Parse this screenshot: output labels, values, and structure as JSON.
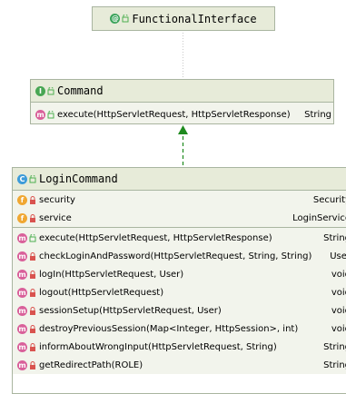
{
  "colors": {
    "node_border": "#a9b5a0",
    "header_bg": "#e7ebd9",
    "body_bg": "#f2f4ec",
    "arrow": "#1e8a1e",
    "icon_annotation": "#3aa35a",
    "icon_interface": "#48a653",
    "icon_class": "#3d9bd9",
    "icon_field": "#f0a732",
    "icon_method": "#d9609a",
    "public_icon": "#4caf50",
    "private_icon": "#d9534f"
  },
  "nodes": {
    "functional_interface": {
      "icon": "@",
      "visibility": "public",
      "title": "FunctionalInterface"
    },
    "command": {
      "icon": "I",
      "visibility": "public",
      "title": "Command",
      "methods": [
        {
          "icon": "m",
          "visibility": "public",
          "signature": "execute(HttpServletRequest, HttpServletResponse)",
          "type": "String"
        }
      ]
    },
    "login_command": {
      "icon": "C",
      "visibility": "public",
      "title": "LoginCommand",
      "fields": [
        {
          "icon": "f",
          "visibility": "private",
          "name": "security",
          "type": "Security"
        },
        {
          "icon": "f",
          "visibility": "private",
          "name": "service",
          "type": "LoginService"
        }
      ],
      "methods": [
        {
          "icon": "m",
          "visibility": "public",
          "signature": "execute(HttpServletRequest, HttpServletResponse)",
          "type": "String"
        },
        {
          "icon": "m",
          "visibility": "private",
          "signature": "checkLoginAndPassword(HttpServletRequest, String, String)",
          "type": "User"
        },
        {
          "icon": "m",
          "visibility": "private",
          "signature": "logIn(HttpServletRequest, User)",
          "type": "void"
        },
        {
          "icon": "m",
          "visibility": "private",
          "signature": "logout(HttpServletRequest)",
          "type": "void"
        },
        {
          "icon": "m",
          "visibility": "private",
          "signature": "sessionSetup(HttpServletRequest, User)",
          "type": "void"
        },
        {
          "icon": "m",
          "visibility": "private",
          "signature": "destroyPreviousSession(Map<Integer, HttpSession>, int)",
          "type": "void"
        },
        {
          "icon": "m",
          "visibility": "private",
          "signature": "informAboutWrongInput(HttpServletRequest, String)",
          "type": "String"
        },
        {
          "icon": "m",
          "visibility": "private",
          "signature": "getRedirectPath(ROLE)",
          "type": "String"
        }
      ]
    }
  },
  "edges": [
    {
      "from": "command",
      "to": "functional_interface",
      "kind": "annotation",
      "style": "dotted"
    },
    {
      "from": "login_command",
      "to": "command",
      "kind": "implements",
      "style": "dashed-arrow"
    }
  ]
}
